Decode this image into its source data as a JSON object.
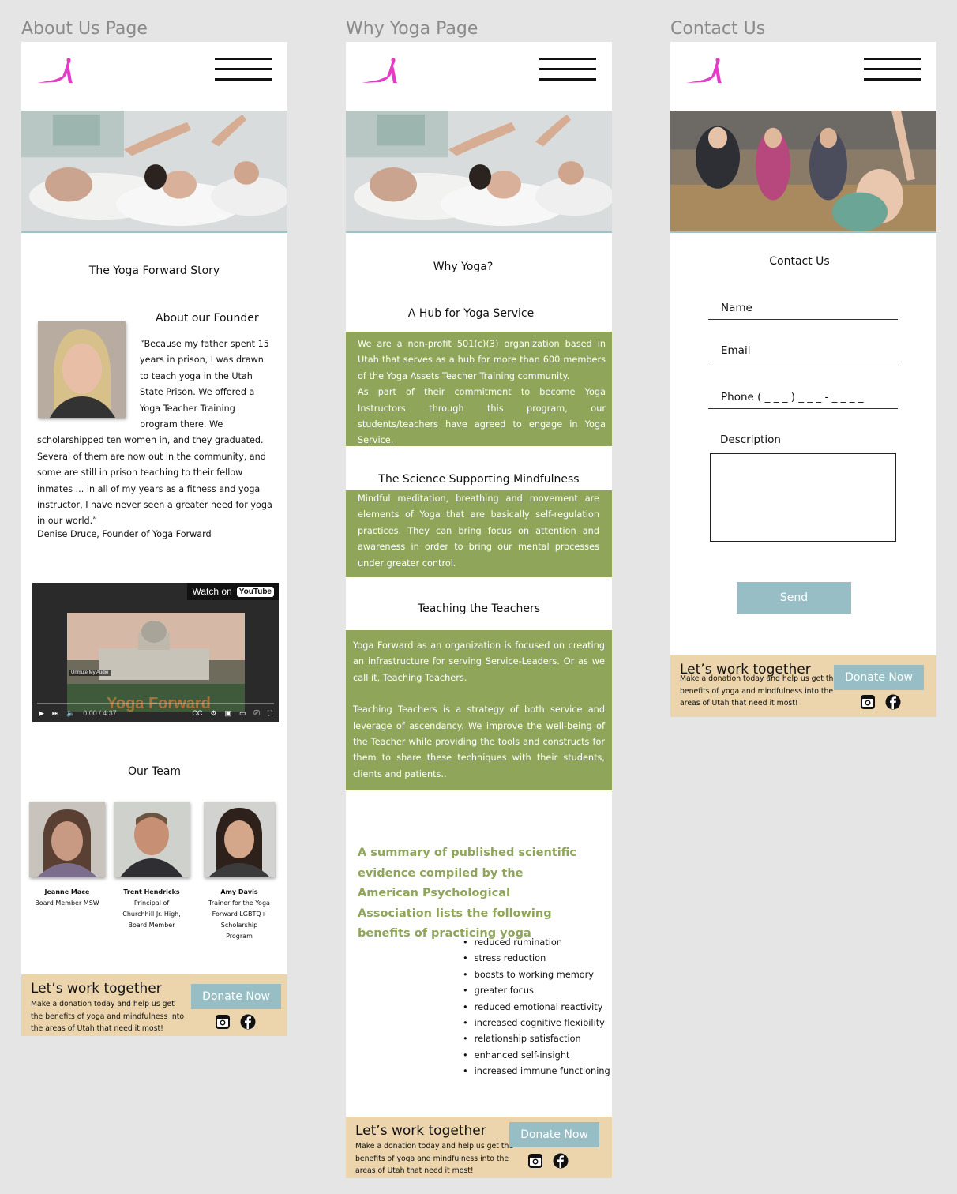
{
  "labels": {
    "about": "About Us Page",
    "why": "Why Yoga Page",
    "contact": "Contact Us"
  },
  "about": {
    "story_title": "The Yoga Forward Story",
    "founder_title": "About our Founder",
    "quote": "“Because my father spent 15 years in prison, I was drawn to teach yoga in the Utah State Prison. We offered a Yoga Teacher Training program there. We scholarshipped ten women in, and they graduated. Several of them are now out in the community, and some are still in prison teaching to their fellow inmates ... in all of my years as a fitness and yoga instructor, I have never seen a greater need for yoga in our world.”",
    "signature": "Denise Druce, Founder of Yoga Forward",
    "video": {
      "watch_on": "Watch on",
      "youtube": "YouTube",
      "overlay_title": "Yoga Forward",
      "unmute": "Unmute My Audio",
      "time": "0:00 / 4:37"
    },
    "team_title": "Our Team",
    "team": [
      {
        "name": "Jeanne Mace",
        "role": "Board Member MSW"
      },
      {
        "name": "Trent Hendricks",
        "role": "Principal of Churchhill Jr. High, Board Member"
      },
      {
        "name": "Amy Davis",
        "role": "Trainer for the Yoga Forward LGBTQ+ Scholarship Program"
      }
    ]
  },
  "why": {
    "title": "Why Yoga?",
    "hub_title": "A Hub for Yoga Service",
    "hub_text_1": "We are a non-profit 501(c)(3) organization based in Utah that serves as a hub for more than 600 members of the Yoga Assets Teacher Training community.",
    "hub_text_2": "As part of their commitment to become Yoga Instructors through this program, our students/teachers have agreed to engage in Yoga Service.",
    "science_title": "The Science Supporting Mindfulness",
    "science_text": "Mindful meditation, breathing and movement are elements of Yoga that are basically self-regulation practices. They can bring focus on attention and awareness in order to bring our mental processes under greater control.",
    "teachers_title": "Teaching the Teachers",
    "teachers_text_1": "Yoga Forward as an organization is focused on creating an infrastructure for serving Service-Leaders. Or as we call it, Teaching Teachers.",
    "teachers_text_2": "Teaching Teachers is a strategy of both service and leverage of ascendancy.  We improve the well-being of the Teacher while providing the tools and constructs for them to share these techniques with their students, clients and patients..",
    "summary": "A summary of published scientific evidence compiled by the American Psychological Association lists the following benefits of practicing yoga",
    "benefits": [
      "reduced rumination",
      "stress reduction",
      "boosts to working memory",
      "greater focus",
      "reduced emotional reactivity",
      "increased cognitive flexibility",
      "relationship satisfaction",
      "enhanced self-insight",
      "increased immune functioning"
    ]
  },
  "contact": {
    "title": "Contact Us",
    "name_label": "Name",
    "email_label": "Email",
    "phone_label": "Phone ( _ _ _ ) _ _ _ - _ _ _ _",
    "description_label": "Description",
    "send_label": "Send"
  },
  "footer": {
    "title": "Let’s work together",
    "text": "Make a donation today and help us get the benefits of yoga and mindfulness into the areas of Utah that need it most!",
    "donate_label": "Donate Now"
  },
  "colors": {
    "brand_pink": "#e63bc8",
    "green": "#8fa65a",
    "teal_button": "#96bec4",
    "footer_bg": "#ecd5ad"
  },
  "icons": [
    "yoga-pose-logo-icon",
    "hamburger-menu-icon",
    "instagram-icon",
    "facebook-icon",
    "play-icon",
    "volume-icon",
    "settings-icon",
    "fullscreen-icon"
  ]
}
